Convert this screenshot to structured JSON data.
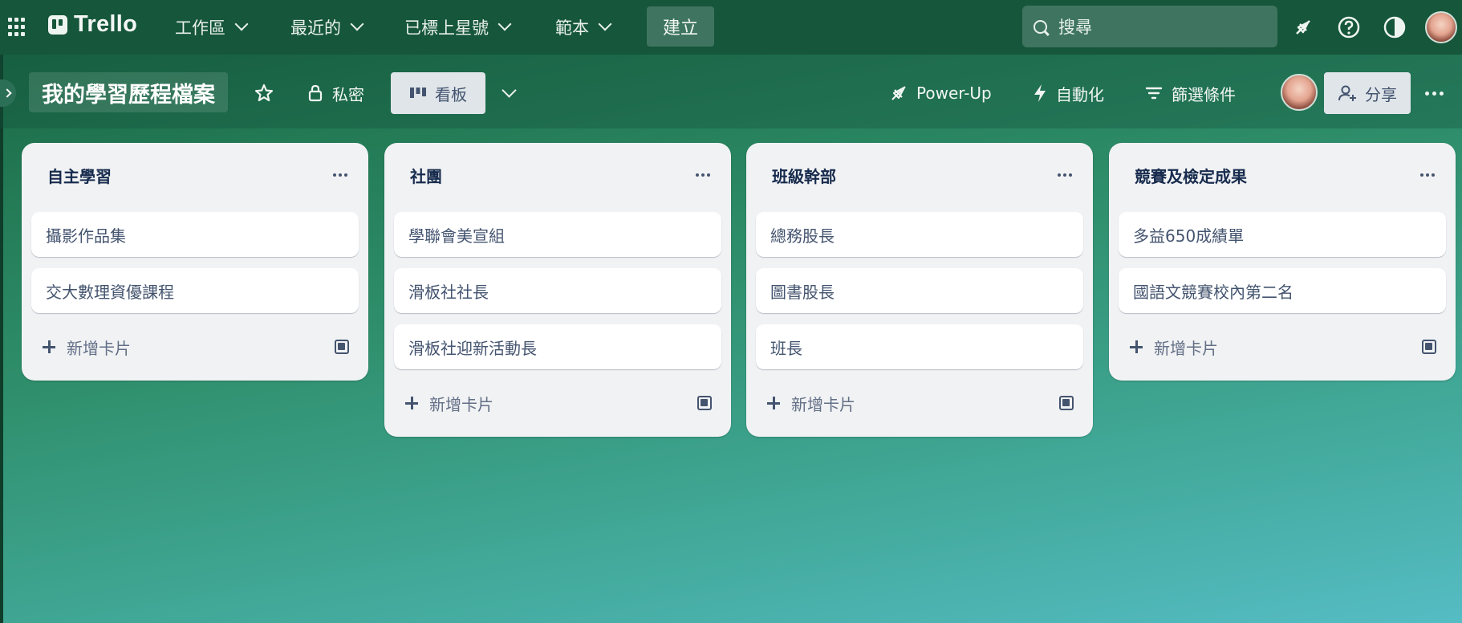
{
  "app": {
    "logo_text": "Trello"
  },
  "topnav": {
    "menus": [
      {
        "label": "工作區"
      },
      {
        "label": "最近的"
      },
      {
        "label": "已標上星號"
      },
      {
        "label": "範本"
      }
    ],
    "create_label": "建立",
    "search_placeholder": "搜尋",
    "icons": [
      "notifications-icon",
      "help-icon",
      "theme-icon",
      "avatar"
    ]
  },
  "board": {
    "title": "我的學習歷程檔案",
    "visibility_label": "私密",
    "view_label": "看板",
    "powerup_label": "Power-Up",
    "automation_label": "自動化",
    "filter_label": "篩選條件",
    "share_label": "分享"
  },
  "lists": [
    {
      "title": "自主學習",
      "cards": [
        "攝影作品集",
        "交大數理資優課程"
      ],
      "add_label": "新增卡片"
    },
    {
      "title": "社團",
      "cards": [
        "學聯會美宣組",
        "滑板社社長",
        "滑板社迎新活動長"
      ],
      "add_label": "新增卡片"
    },
    {
      "title": "班級幹部",
      "cards": [
        "總務股長",
        "圖書股長",
        "班長"
      ],
      "add_label": "新增卡片"
    },
    {
      "title": "競賽及檢定成果",
      "cards": [
        "多益650成績單",
        "國語文競賽校內第二名"
      ],
      "add_label": "新增卡片"
    }
  ],
  "colors": {
    "topbar": "#16563a",
    "list_bg": "#f1f2f4",
    "card_bg": "#ffffff",
    "accent_button": "#3f7560"
  }
}
